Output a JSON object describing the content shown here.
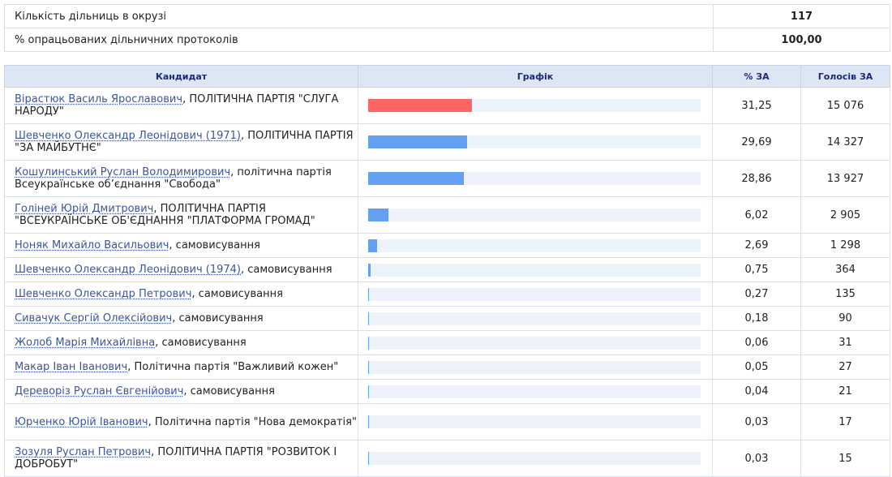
{
  "summary": [
    {
      "label": "Кількість дільниць в окрузі",
      "value": "117"
    },
    {
      "label": "% опрацьованих дільничних протоколів",
      "value": "100,00"
    }
  ],
  "headers": {
    "candidate": "Кандидат",
    "chart": "Графік",
    "percent": "% ЗА",
    "votes": "Голосів ЗА"
  },
  "colors": {
    "leader_bar": "#ff6464",
    "bar": "#64a0f0",
    "bar_track": "#eef3fb"
  },
  "rows": [
    {
      "name": "Вірастюк Василь Ярославович",
      "party": ", ПОЛІТИЧНА ПАРТІЯ \"СЛУГА НАРОДУ\"",
      "percent": "31,25",
      "votes": "15 076",
      "bar_fraction": 0.3125,
      "leader": true
    },
    {
      "name": "Шевченко Олександр Леонідович (1971)",
      "party": ", ПОЛІТИЧНА ПАРТІЯ \"ЗА МАЙБУТНЄ\"",
      "percent": "29,69",
      "votes": "14 327",
      "bar_fraction": 0.2969
    },
    {
      "name": "Кошулинський Руслан Володимирович",
      "party": ", політична партія Всеукраїнське об’єднання \"Свобода\"",
      "percent": "28,86",
      "votes": "13 927",
      "bar_fraction": 0.2886
    },
    {
      "name": "Голіней Юрій Дмитрович",
      "party": ", ПОЛІТИЧНА ПАРТІЯ \"ВСЕУКРАЇНСЬКЕ ОБ'ЄДНАННЯ \"ПЛАТФОРМА ГРОМАД\"",
      "percent": "6,02",
      "votes": "2 905",
      "bar_fraction": 0.0602
    },
    {
      "name": "Ноняк Михайло Васильович",
      "party": ", самовисування",
      "percent": "2,69",
      "votes": "1 298",
      "bar_fraction": 0.0269
    },
    {
      "name": "Шевченко Олександр Леонідович (1974)",
      "party": ", самовисування",
      "percent": "0,75",
      "votes": "364",
      "bar_fraction": 0.0075
    },
    {
      "name": "Шевченко Олександр Петрович",
      "party": ", самовисування",
      "percent": "0,27",
      "votes": "135",
      "bar_fraction": 0.0027
    },
    {
      "name": "Сивачук Сергій Олексійович",
      "party": ", самовисування",
      "percent": "0,18",
      "votes": "90",
      "bar_fraction": 0.0018
    },
    {
      "name": "Жолоб Марія Михайлівна",
      "party": ", самовисування",
      "percent": "0,06",
      "votes": "31",
      "bar_fraction": 0.0006
    },
    {
      "name": "Макар Іван Іванович",
      "party": ", Політична партія \"Важливий кожен\"",
      "percent": "0,05",
      "votes": "27",
      "bar_fraction": 0.0005
    },
    {
      "name": "Дереворіз Руслан Євгенійович",
      "party": ", самовисування",
      "percent": "0,04",
      "votes": "21",
      "bar_fraction": 0.0004
    },
    {
      "name": "Юрченко Юрій Іванович",
      "party": ", Політична партія \"Нова демократія\"",
      "percent": "0,03",
      "votes": "17",
      "bar_fraction": 0.0003
    },
    {
      "name": "Зозуля Руслан Петрович",
      "party": ", ПОЛІТИЧНА ПАРТІЯ \"РОЗВИТОК І ДОБРОБУТ\"",
      "percent": "0,03",
      "votes": "15",
      "bar_fraction": 0.0003
    }
  ]
}
